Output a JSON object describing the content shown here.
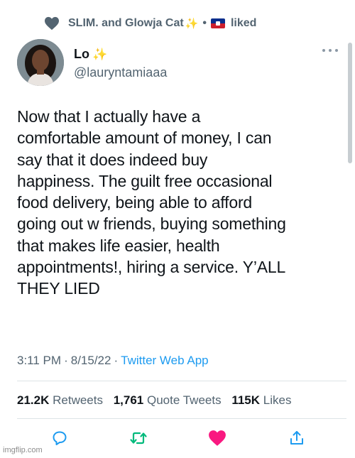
{
  "social_context": {
    "likers": "SLIM. and Glowja Cat",
    "sparkle": "✨",
    "separator": "•",
    "action": "liked"
  },
  "tweet": {
    "display_name": "Lo",
    "name_emoji": "✨",
    "handle": "@lauryntamiaaa",
    "text": "Now that I actually have a\ncomfortable amount of money, I can\nsay that it does indeed buy\nhappiness. The guilt free occasional\nfood delivery, being able to afford\ngoing out w friends, buying something\nthat makes life easier, health\nappointments!, hiring a service. Y’ALL\nTHEY LIED",
    "time": "3:11 PM",
    "date": "8/15/22",
    "dot": "·",
    "source": "Twitter Web App"
  },
  "stats": {
    "retweets_count": "21.2K",
    "retweets_label": "Retweets",
    "quotes_count": "1,761",
    "quotes_label": "Quote Tweets",
    "likes_count": "115K",
    "likes_label": "Likes"
  },
  "icons": {
    "heart_gray": "heart-icon",
    "reply": "reply-icon",
    "retweet": "retweet-icon",
    "like": "like-icon",
    "share": "share-icon",
    "more": "more-icon",
    "flag": "haiti-flag-icon"
  },
  "colors": {
    "text": "#0f1419",
    "secondary": "#536471",
    "link": "#1d9bf0",
    "retweet_green": "#00ba7c",
    "like_pink": "#f91880"
  },
  "watermark": "imgflip.com"
}
